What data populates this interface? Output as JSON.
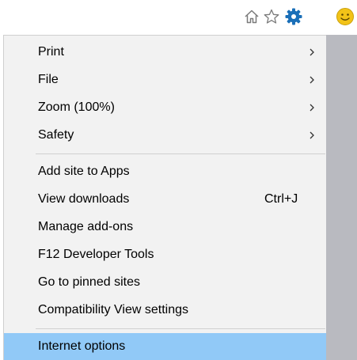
{
  "toolbar": {
    "icons": [
      "home-icon",
      "star-icon",
      "gear-icon",
      "smiley-icon"
    ]
  },
  "colors": {
    "gear": "#1a6fb8",
    "smiley": "#f2c318",
    "highlight": "#91c9f7",
    "menu_bg": "#f2f2f2",
    "side_strip": "#b9bac0"
  },
  "menu": {
    "items": [
      {
        "label": "Print",
        "submenu": true
      },
      {
        "label": "File",
        "submenu": true
      },
      {
        "label": "Zoom (100%)",
        "submenu": true
      },
      {
        "label": "Safety",
        "submenu": true
      },
      {
        "label": "Add site to Apps"
      },
      {
        "label": "View downloads",
        "shortcut": "Ctrl+J"
      },
      {
        "label": "Manage add-ons"
      },
      {
        "label": "F12 Developer Tools"
      },
      {
        "label": "Go to pinned sites"
      },
      {
        "label": "Compatibility View settings"
      },
      {
        "label": "Internet options",
        "highlighted": true
      }
    ]
  }
}
